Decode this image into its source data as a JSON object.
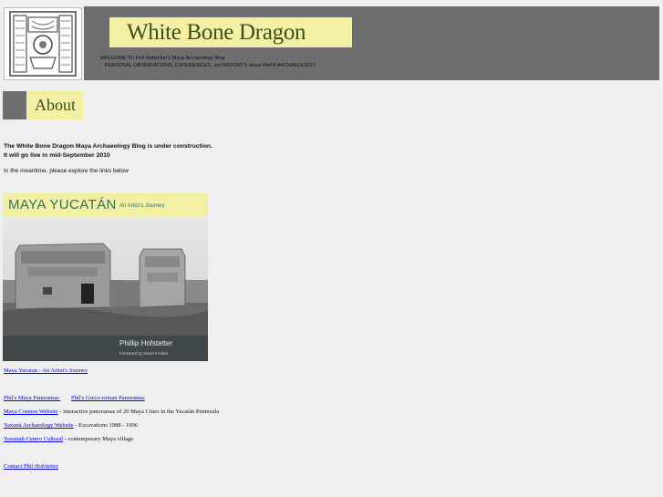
{
  "header": {
    "title": "White Bone Dragon",
    "welcome_line1": "WELCOME TO Phil Hofstetter's Maya Archaeology Blog",
    "welcome_line2": "PERSONAL OBSERVATIONS, EXPERIENCES, and REPORTS about MAYA ARCHAEOLOGY"
  },
  "about_tab": {
    "label": "About"
  },
  "content": {
    "notice_line1": "The White Bone Dragon Maya Archaeology Blog is under construction.",
    "notice_line2": "It will go live in mid-September 2010",
    "explore": "In the meantime, please explore the links below"
  },
  "book": {
    "title": "MAYA YUCATÁN",
    "subtitle": "An Artist's Journey",
    "author": "Phillip Hofstetter",
    "foreword": "Foreword by David Freidel"
  },
  "links": {
    "book_link": "Maya Yucatan - An Artist's Journey",
    "panoramas": "Phil's Maya Panoramas ",
    "greco_panoramas": "Phil's Greco-roman Panoramas",
    "cosmos": "Maya Cosmos Website",
    "cosmos_desc": " - interactive panoramas of 20 Maya Cities in the Yucatán Peninsula",
    "yaxuna_arch": "Yaxuná Archaeology Website",
    "yaxuna_arch_desc": " - Excavations 1988 - 1996",
    "yaxunah_centro": "Yaxunah Centro Cultural",
    "yaxunah_centro_desc": " - contemporary Maya village",
    "contact": "Contact Phil Hofstetter"
  }
}
